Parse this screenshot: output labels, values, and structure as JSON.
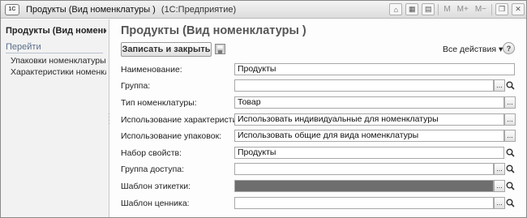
{
  "titlebar": {
    "app_logo": "1C",
    "title": "Продукты (Вид номенклатуры )",
    "subtitle": "(1С:Предприятие)",
    "memory_buttons": [
      "M",
      "M+",
      "M−"
    ]
  },
  "sidebar": {
    "title": "Продукты (Вид номенк...",
    "goto": "Перейти",
    "links": [
      "Упаковки номенклатуры",
      "Характеристики номенкл..."
    ]
  },
  "main": {
    "title": "Продукты (Вид номенклатуры )",
    "save_close_label": "Записать и закрыть",
    "all_actions_label": "Все действия ▾",
    "help_label": "?"
  },
  "fields": [
    {
      "label": "Наименование:",
      "value": "Продукты",
      "select_btn": false,
      "open_btn": false
    },
    {
      "label": "Группа:",
      "value": "",
      "select_btn": true,
      "open_btn": true
    },
    {
      "label": "Тип номенклатуры:",
      "value": "Товар",
      "select_btn": true,
      "open_btn": false
    },
    {
      "label": "Использование характеристик:",
      "value": "Использовать индивидуальные для номенклатуры",
      "select_btn": true,
      "open_btn": false
    },
    {
      "label": "Использование упаковок:",
      "value": "Использовать общие для вида номенклатуры",
      "select_btn": true,
      "open_btn": false
    },
    {
      "label": "Набор свойств:",
      "value": "Продукты",
      "select_btn": false,
      "open_btn": true
    },
    {
      "label": "Группа доступа:",
      "value": "",
      "select_btn": true,
      "open_btn": true
    },
    {
      "label": "Шаблон этикетки:",
      "value": "",
      "select_btn": true,
      "open_btn": true,
      "dark": true
    },
    {
      "label": "Шаблон ценника:",
      "value": "",
      "select_btn": true,
      "open_btn": true
    }
  ],
  "icons": {
    "select": "...",
    "open": "magnifier-icon"
  }
}
